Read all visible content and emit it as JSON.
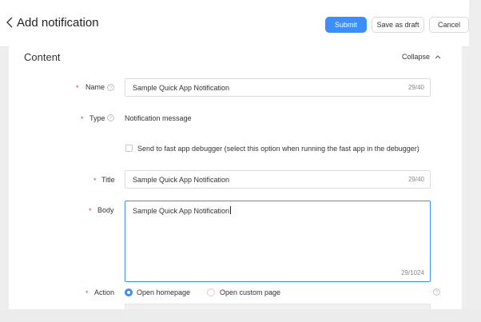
{
  "header": {
    "title": "Add notification",
    "submit_label": "Submit",
    "draft_label": "Save as draft",
    "cancel_label": "Cancel"
  },
  "section": {
    "title": "Content",
    "collapse_label": "Collapse"
  },
  "form": {
    "required_mark": "*",
    "name": {
      "label": "Name",
      "value": "Sample Quick App Notification",
      "count": "29/40"
    },
    "type": {
      "label": "Type",
      "value": "Notification message",
      "debugger_option": "Send to fast app debugger (select this option when running the fast app in the debugger)"
    },
    "title": {
      "label": "Title",
      "value": "Sample Quick App Notification",
      "count": "29/40"
    },
    "body": {
      "label": "Body",
      "value": "Sample Quick App Notification",
      "count": "29/1024"
    },
    "action": {
      "label": "Action",
      "options": [
        "Open homepage",
        "Open custom page"
      ],
      "selected": "Open homepage"
    }
  },
  "colors": {
    "accent": "#3d8ef8",
    "required": "#e34040"
  },
  "icons": [
    "back-icon",
    "chevron-up-icon",
    "help-icon"
  ]
}
